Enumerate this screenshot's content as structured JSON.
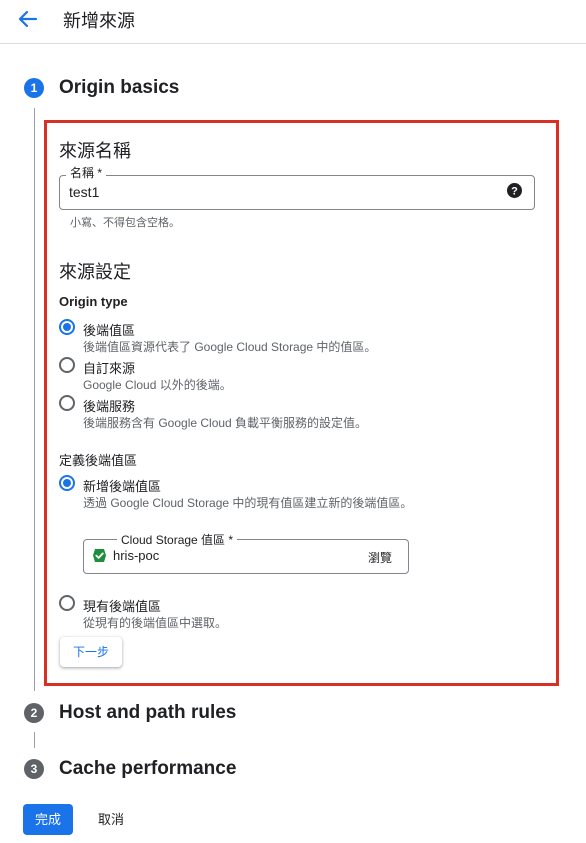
{
  "header": {
    "title": "新增來源"
  },
  "steps": [
    {
      "number": "1",
      "title": "Origin basics"
    },
    {
      "number": "2",
      "title": "Host and path rules"
    },
    {
      "number": "3",
      "title": "Cache performance"
    }
  ],
  "origin_name": {
    "section_title": "來源名稱",
    "field_label": "名稱 *",
    "value": "test1",
    "hint": "小寫、不得包含空格。"
  },
  "origin_settings": {
    "section_title": "來源設定",
    "origin_type_label": "Origin type",
    "options": [
      {
        "label": "後端值區",
        "desc": "後端值區資源代表了 Google Cloud Storage 中的值區。",
        "checked": true
      },
      {
        "label": "自訂來源",
        "desc": "Google Cloud 以外的後端。",
        "checked": false
      },
      {
        "label": "後端服務",
        "desc": "後端服務含有 Google Cloud 負載平衡服務的設定值。",
        "checked": false
      }
    ]
  },
  "define_bucket": {
    "label": "定義後端值區",
    "new_option": {
      "label": "新增後端值區",
      "desc": "透過 Google Cloud Storage 中的現有值區建立新的後端值區。",
      "checked": true
    },
    "storage_field": {
      "label": "Cloud Storage 值區 *",
      "value": "hris-poc",
      "browse": "瀏覽"
    },
    "existing_option": {
      "label": "現有後端值區",
      "desc": "從現有的後端值區中選取。",
      "checked": false
    }
  },
  "buttons": {
    "next": "下一步",
    "done": "完成",
    "cancel": "取消"
  },
  "colors": {
    "primary": "#1a73e8",
    "highlight_border": "#d93025",
    "bucket_icon": "#1e8e3e"
  }
}
